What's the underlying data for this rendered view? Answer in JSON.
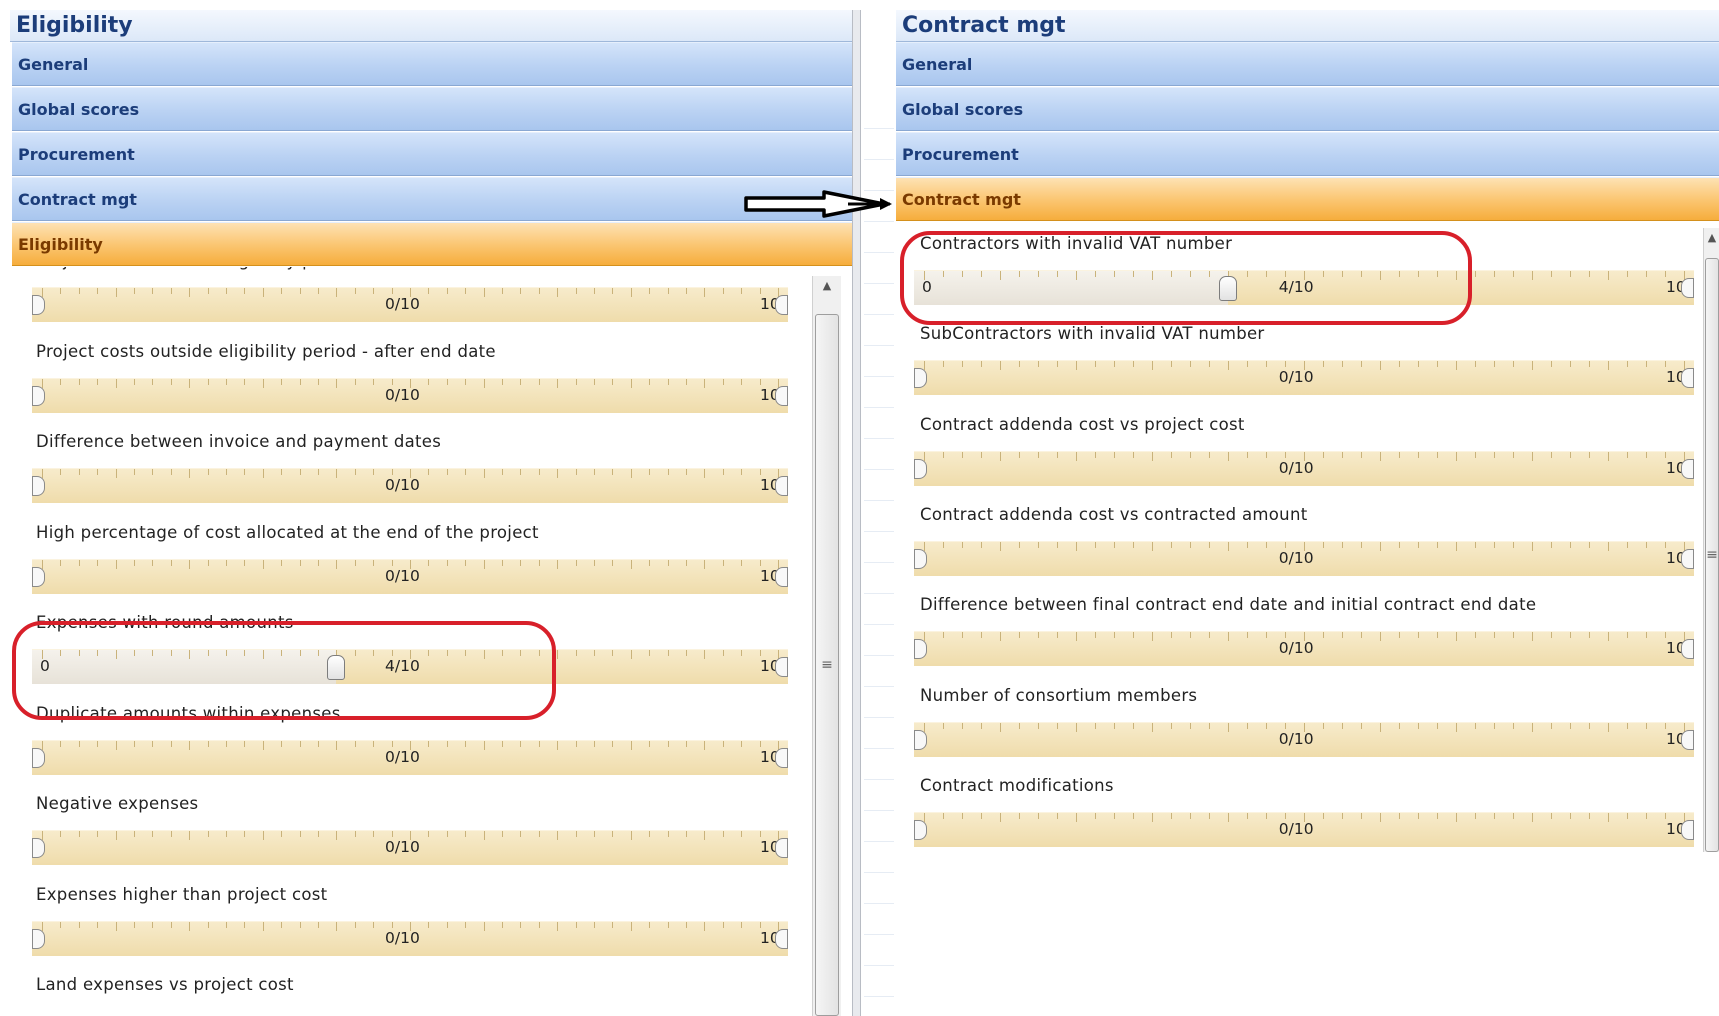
{
  "left": {
    "title": "Eligibility",
    "headers": [
      "General",
      "Global scores",
      "Procurement",
      "Contract mgt"
    ],
    "active_header": "Eligibility",
    "criteria": [
      {
        "label": "Project costs outside eligibility period - before start date",
        "min": "0",
        "value": "0/10",
        "max": "10",
        "level": 0.0
      },
      {
        "label": "Project costs outside eligibility period - after end date",
        "min": "0",
        "value": "0/10",
        "max": "10",
        "level": 0.0
      },
      {
        "label": "Difference between invoice and payment dates",
        "min": "0",
        "value": "0/10",
        "max": "10",
        "level": 0.0
      },
      {
        "label": "High percentage of cost allocated at the end of the project",
        "min": "0",
        "value": "0/10",
        "max": "10",
        "level": 0.0
      },
      {
        "label": "Expenses with round amounts",
        "min": "0",
        "value": "4/10",
        "max": "10",
        "level": 0.4
      },
      {
        "label": "Duplicate amounts within expenses",
        "min": "0",
        "value": "0/10",
        "max": "10",
        "level": 0.0
      },
      {
        "label": "Negative expenses",
        "min": "0",
        "value": "0/10",
        "max": "10",
        "level": 0.0
      },
      {
        "label": "Expenses higher than project cost",
        "min": "0",
        "value": "0/10",
        "max": "10",
        "level": 0.0
      },
      {
        "label": "Land expenses vs project cost"
      }
    ]
  },
  "right": {
    "title": "Contract mgt",
    "headers": [
      "General",
      "Global scores",
      "Procurement"
    ],
    "active_header": "Contract mgt",
    "criteria": [
      {
        "label": "Contractors with invalid VAT number",
        "min": "0",
        "value": "4/10",
        "max": "10",
        "level": 0.4
      },
      {
        "label": "SubContractors with invalid VAT number",
        "min": "0",
        "value": "0/10",
        "max": "10",
        "level": 0.0
      },
      {
        "label": "Contract addenda cost vs project cost",
        "min": "0",
        "value": "0/10",
        "max": "10",
        "level": 0.0
      },
      {
        "label": "Contract addenda cost vs contracted amount",
        "min": "0",
        "value": "0/10",
        "max": "10",
        "level": 0.0
      },
      {
        "label": "Difference between final contract end date and initial contract end date",
        "min": "0",
        "value": "0/10",
        "max": "10",
        "level": 0.0
      },
      {
        "label": "Number of consortium members",
        "min": "0",
        "value": "0/10",
        "max": "10",
        "level": 0.0
      },
      {
        "label": "Contract modifications",
        "min": "0",
        "value": "0/10",
        "max": "10",
        "level": 0.0
      }
    ]
  },
  "colors": {
    "highlight": "#d8202a",
    "active_header": "#f6ad3c",
    "header": "#bad2f3"
  },
  "icons": {
    "arrow": "right-arrow-icon",
    "scroll_up": "scroll-up-arrow-icon",
    "grip": "scroll-grip-icon"
  }
}
